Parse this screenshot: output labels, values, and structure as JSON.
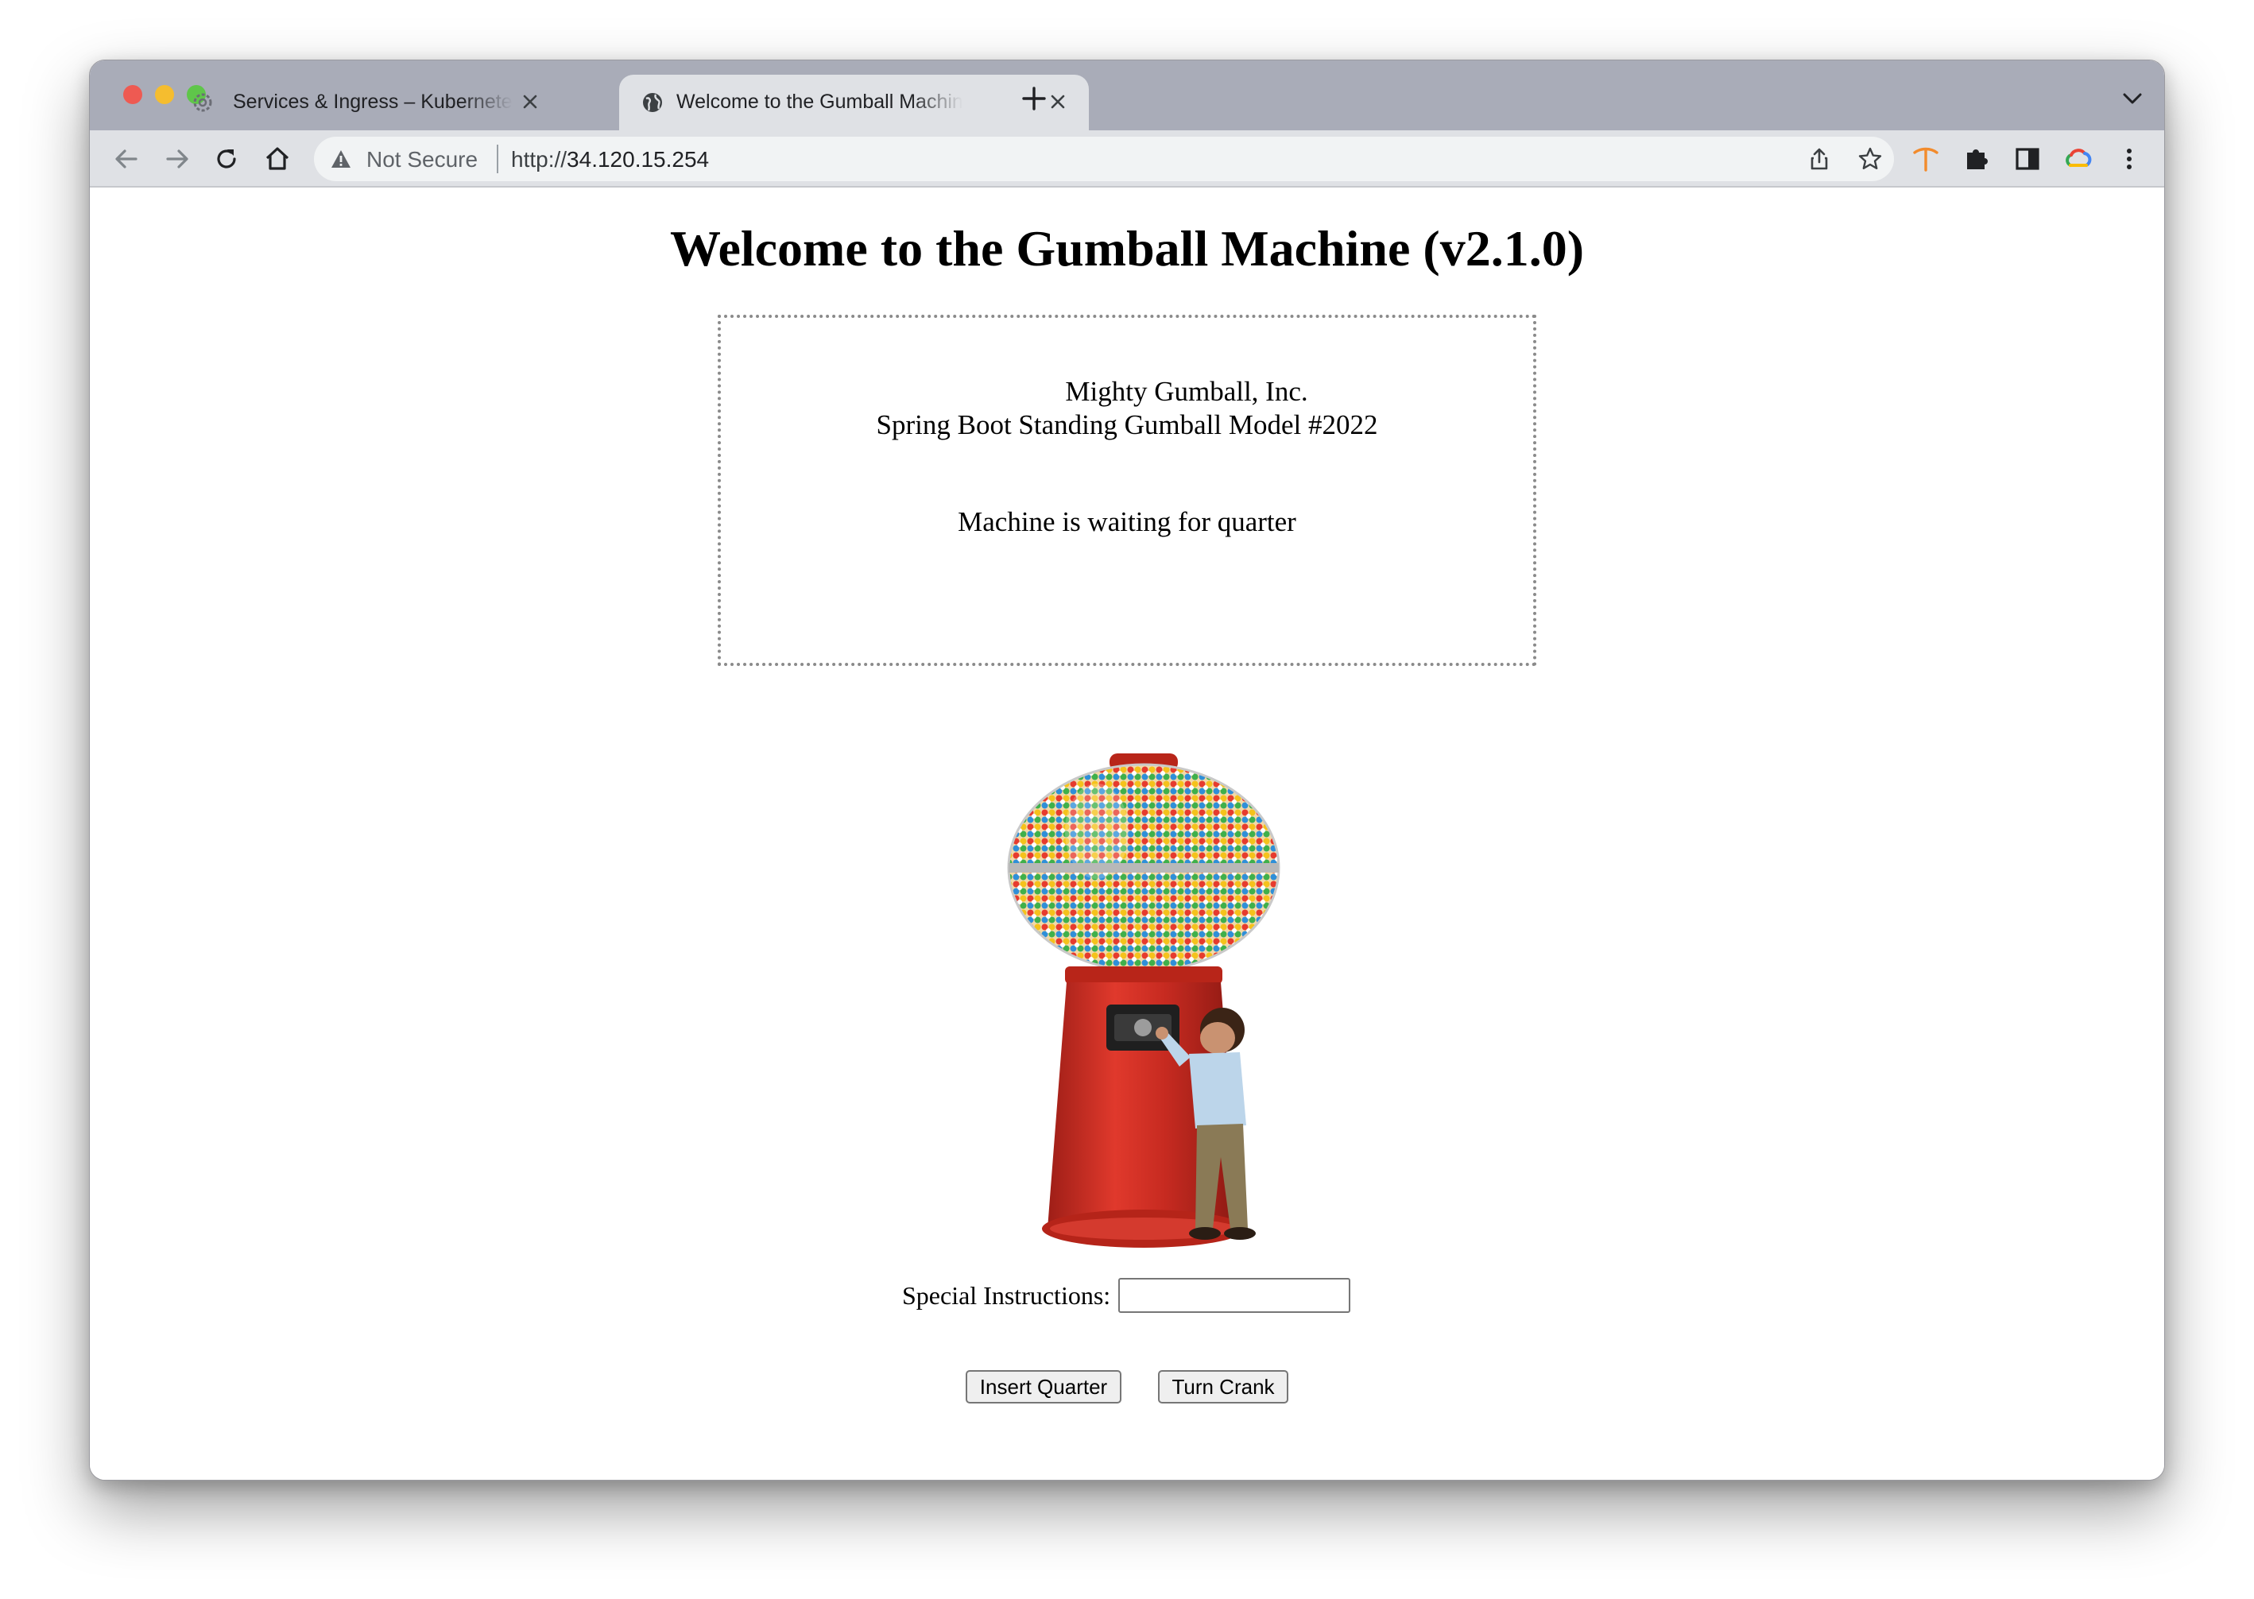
{
  "browser": {
    "tabs": [
      {
        "title": "Services & Ingress – Kubernetes",
        "icon": "kubernetes-gear-icon",
        "active": false
      },
      {
        "title": "Welcome to the Gumball Machine",
        "icon": "globe-icon",
        "active": true
      }
    ],
    "address_bar": {
      "security_label": "Not Secure",
      "url_scheme": "http://",
      "url_host": "34.120.15.254"
    },
    "colors": {
      "tabstrip": "#a9acb8",
      "toolbar": "#dfe1e5",
      "extension_accent": "#f28b2c"
    }
  },
  "page": {
    "title": "Welcome to the Gumball Machine (v2.1.0)",
    "status_box": {
      "company": "Mighty Gumball, Inc.",
      "model": "Spring Boot Standing Gumball Model #2022",
      "state": "Machine is waiting for quarter"
    },
    "image": {
      "subject": "gumball-machine-with-child"
    },
    "form": {
      "instructions_label": "Special Instructions:",
      "instructions_value": "",
      "insert_quarter_label": "Insert Quarter",
      "turn_crank_label": "Turn Crank"
    }
  }
}
